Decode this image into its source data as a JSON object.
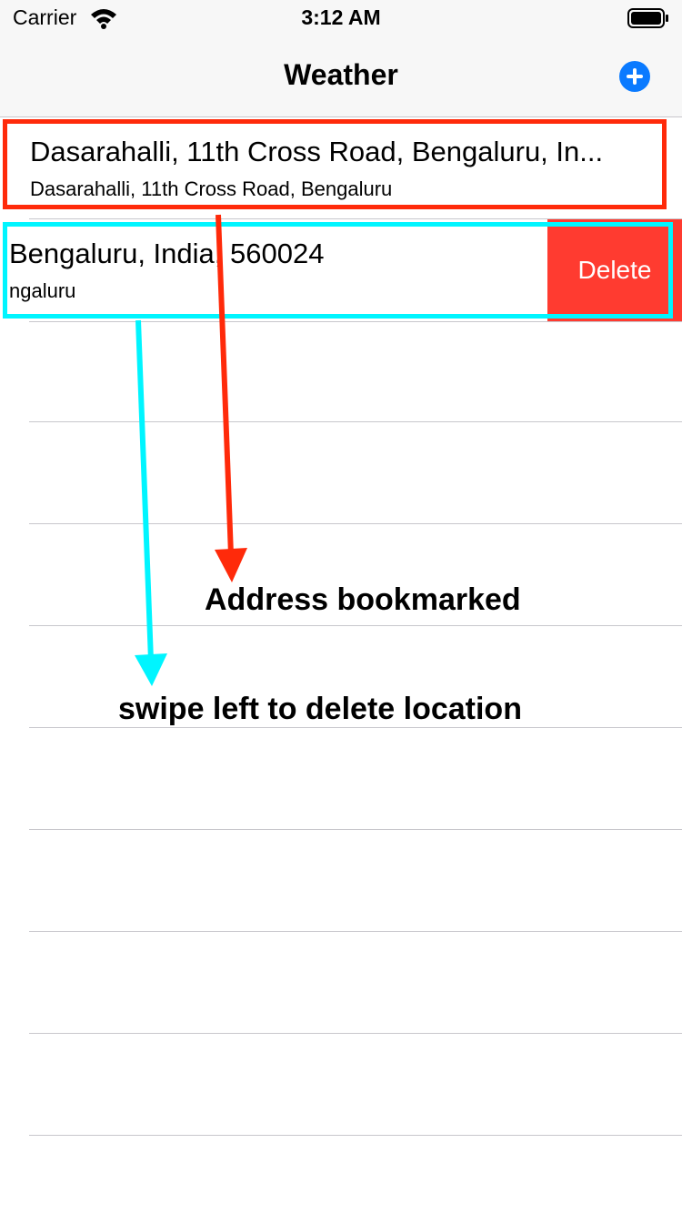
{
  "status_bar": {
    "carrier": "Carrier",
    "time": "3:12 AM",
    "wifi_icon": "wifi-icon",
    "battery_icon": "battery-icon"
  },
  "nav": {
    "title": "Weather",
    "add_icon": "plus-circle-icon",
    "accent_color": "#0a7aff"
  },
  "locations": [
    {
      "title": "Dasarahalli, 11th Cross Road, Bengaluru, In...",
      "subtitle": "Dasarahalli, 11th Cross Road, Bengaluru"
    },
    {
      "title": "Bengaluru, India, 560024",
      "subtitle": "ngaluru"
    }
  ],
  "swipe_action": {
    "label": "Delete",
    "color": "#ff3b30"
  },
  "annotations": {
    "bookmarked": {
      "text": "Address bookmarked",
      "color": "#ff2a0a"
    },
    "swipe": {
      "text": "swipe left to delete location",
      "color": "#00f5ff"
    }
  }
}
